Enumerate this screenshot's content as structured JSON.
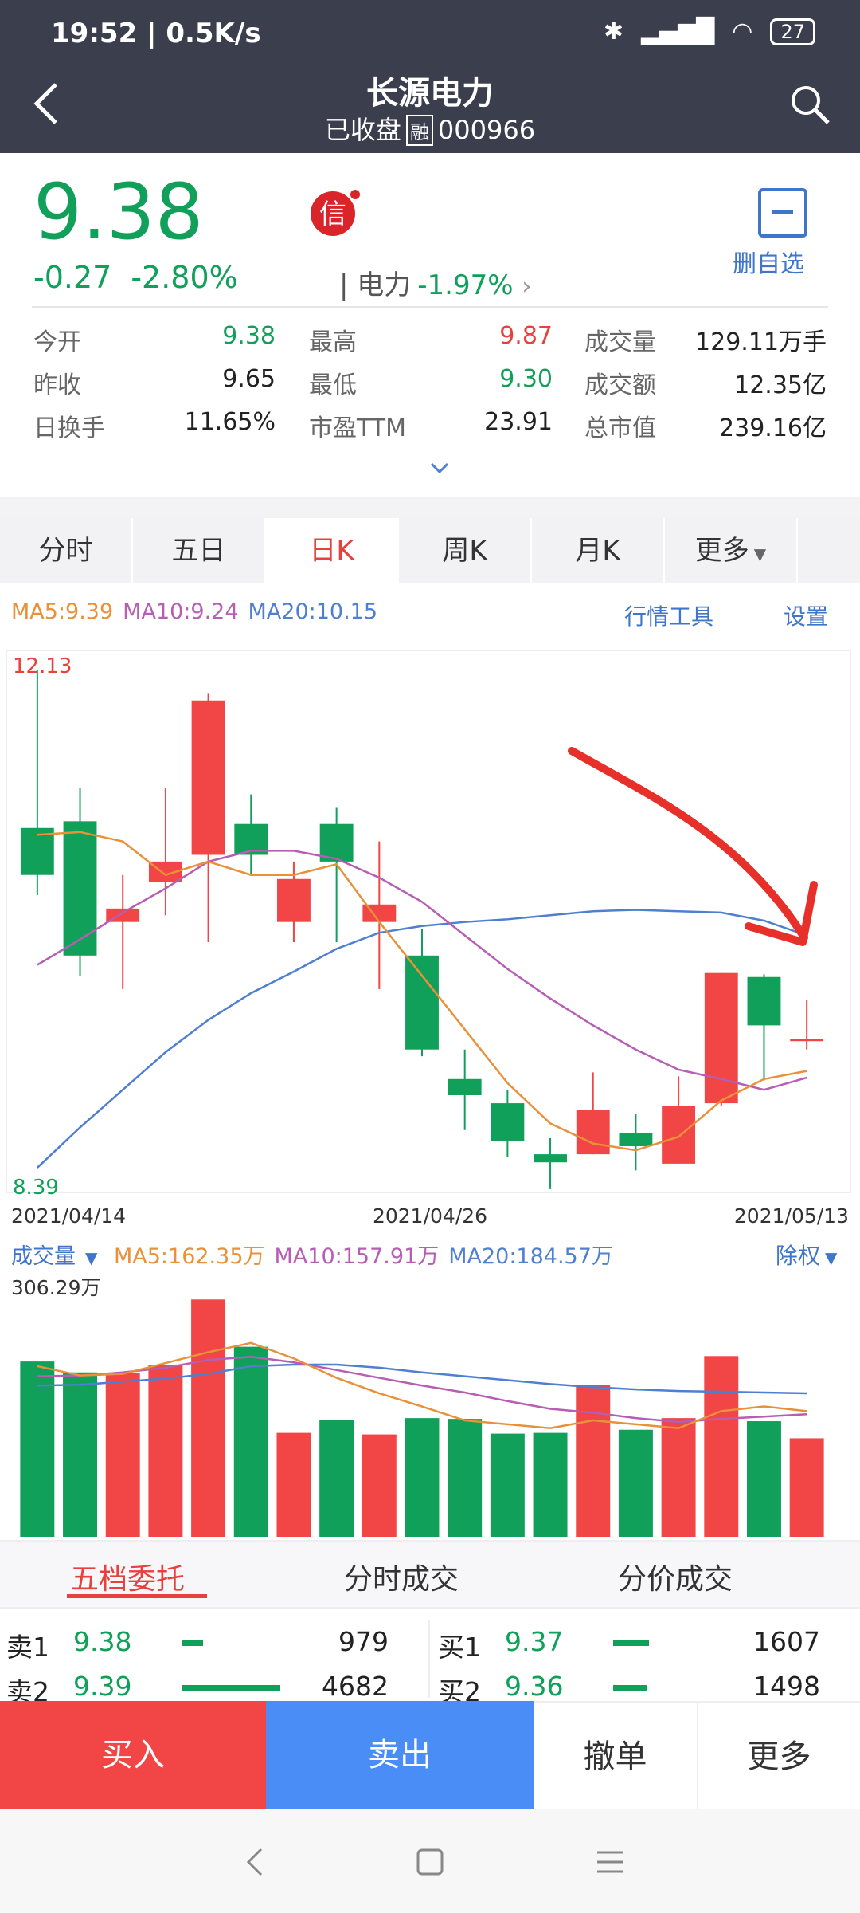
{
  "status": {
    "time": "19:52 | 0.5K/s",
    "battery": "27"
  },
  "header": {
    "name": "长源电力",
    "status": "已收盘",
    "rong": "融",
    "code": "000966"
  },
  "quote": {
    "price": "9.38",
    "change": "-0.27",
    "change_pct": "-2.80%",
    "sector_name": "| 电力",
    "sector_pct": "-1.97%",
    "sector_arrow": "›",
    "watch_label": "删自选",
    "stats": [
      {
        "label": "今开",
        "value": "9.38",
        "color": "green"
      },
      {
        "label": "最高",
        "value": "9.87",
        "color": "red"
      },
      {
        "label": "成交量",
        "value": "129.11万手",
        "color": "black"
      },
      {
        "label": "昨收",
        "value": "9.65",
        "color": "black"
      },
      {
        "label": "最低",
        "value": "9.30",
        "color": "green"
      },
      {
        "label": "成交额",
        "value": "12.35亿",
        "color": "black"
      },
      {
        "label": "日换手",
        "value": "11.65%",
        "color": "black"
      },
      {
        "label": "市盈TTM",
        "value": "23.91",
        "color": "black"
      },
      {
        "label": "总市值",
        "value": "239.16亿",
        "color": "black"
      }
    ]
  },
  "tabs": [
    "分时",
    "五日",
    "日K",
    "周K",
    "月K",
    "更多"
  ],
  "active_tab": 2,
  "kline": {
    "ma5": "MA5:9.39",
    "ma10": "MA10:9.24",
    "ma20": "MA20:10.15",
    "tool_link": "行情工具",
    "settings_link": "设置",
    "vol_label": "成交量",
    "vol_ma5": "MA5:162.35万",
    "vol_ma10": "MA10:157.91万",
    "vol_ma20": "MA20:184.57万",
    "fuquan": "除权",
    "vol_max_label": "306.29万"
  },
  "colors": {
    "up": "#f24545",
    "down": "#11a05a",
    "ma5": "#e8913a",
    "ma10": "#b65db4",
    "ma20": "#4f7fcf"
  },
  "chart_data": {
    "type": "candlestick",
    "price_max_label": "12.13",
    "price_min_label": "8.39",
    "x_labels": [
      "2021/04/14",
      "2021/04/26",
      "2021/05/13"
    ],
    "ylim": [
      8.39,
      12.13
    ],
    "candles": [
      {
        "o": 10.95,
        "c": 10.6,
        "h": 12.13,
        "l": 10.45
      },
      {
        "o": 11.0,
        "c": 10.0,
        "h": 11.25,
        "l": 9.85
      },
      {
        "o": 10.25,
        "c": 10.35,
        "h": 10.6,
        "l": 9.75
      },
      {
        "o": 10.55,
        "c": 10.7,
        "h": 11.25,
        "l": 10.3
      },
      {
        "o": 10.75,
        "c": 11.9,
        "h": 11.95,
        "l": 10.1
      },
      {
        "o": 10.98,
        "c": 10.75,
        "h": 11.2,
        "l": 10.6
      },
      {
        "o": 10.25,
        "c": 10.57,
        "h": 10.7,
        "l": 10.1
      },
      {
        "o": 10.98,
        "c": 10.7,
        "h": 11.1,
        "l": 10.1
      },
      {
        "o": 10.25,
        "c": 10.38,
        "h": 10.85,
        "l": 9.75
      },
      {
        "o": 10.0,
        "c": 9.3,
        "h": 10.2,
        "l": 9.25
      },
      {
        "o": 9.08,
        "c": 8.96,
        "h": 9.3,
        "l": 8.7
      },
      {
        "o": 8.9,
        "c": 8.62,
        "h": 9.0,
        "l": 8.5
      },
      {
        "o": 8.52,
        "c": 8.46,
        "h": 8.64,
        "l": 8.26
      },
      {
        "o": 8.52,
        "c": 8.85,
        "h": 9.13,
        "l": 8.52
      },
      {
        "o": 8.68,
        "c": 8.58,
        "h": 8.82,
        "l": 8.4
      },
      {
        "o": 8.45,
        "c": 8.88,
        "h": 9.1,
        "l": 8.45
      },
      {
        "o": 8.9,
        "c": 9.87,
        "h": 9.87,
        "l": 8.88
      },
      {
        "o": 9.84,
        "c": 9.48,
        "h": 9.86,
        "l": 9.07
      },
      {
        "o": 9.38,
        "c": 9.38,
        "h": 9.67,
        "l": 9.3
      }
    ],
    "ma5": [
      10.9,
      10.92,
      10.85,
      10.6,
      10.7,
      10.6,
      10.6,
      10.68,
      10.25,
      9.85,
      9.45,
      9.05,
      8.75,
      8.6,
      8.55,
      8.65,
      8.92,
      9.08,
      9.14
    ],
    "ma10": [
      9.93,
      10.12,
      10.32,
      10.5,
      10.7,
      10.78,
      10.78,
      10.72,
      10.58,
      10.4,
      10.15,
      9.9,
      9.68,
      9.48,
      9.3,
      9.15,
      9.08,
      9.0,
      9.09
    ],
    "ma20": [
      8.42,
      8.72,
      9.0,
      9.28,
      9.52,
      9.72,
      9.88,
      10.05,
      10.17,
      10.22,
      10.25,
      10.27,
      10.3,
      10.33,
      10.34,
      10.33,
      10.32,
      10.26,
      10.15
    ],
    "volume": {
      "max": 306.29,
      "values": [
        226,
        212,
        211,
        222,
        306,
        245,
        134,
        151,
        132,
        153,
        152,
        133,
        134,
        196,
        138,
        153,
        233,
        149,
        127
      ],
      "ma5": [
        220,
        208,
        210,
        224,
        238,
        250,
        230,
        205,
        185,
        168,
        150,
        145,
        140,
        150,
        145,
        140,
        162,
        168,
        162
      ],
      "ma10": [
        207,
        208,
        212,
        218,
        228,
        232,
        225,
        215,
        205,
        195,
        186,
        175,
        165,
        160,
        153,
        148,
        152,
        155,
        158
      ],
      "ma20": [
        195,
        196,
        200,
        204,
        210,
        220,
        222,
        222,
        218,
        212,
        207,
        202,
        197,
        193,
        190,
        188,
        187,
        186,
        185
      ]
    }
  },
  "orderbook": {
    "tabs": [
      "五档委托",
      "分时成交",
      "分价成交"
    ],
    "sell": [
      {
        "label": "卖1",
        "price": "9.38",
        "vol": "979",
        "bar": 0.22
      },
      {
        "label": "卖2",
        "price": "9.39",
        "vol": "4682",
        "bar": 1.0
      }
    ],
    "buy": [
      {
        "label": "买1",
        "price": "9.37",
        "vol": "1607",
        "bar": 0.36
      },
      {
        "label": "买2",
        "price": "9.36",
        "vol": "1498",
        "bar": 0.34
      }
    ]
  },
  "actions": {
    "buy": "买入",
    "sell": "卖出",
    "cancel": "撤单",
    "more": "更多"
  }
}
